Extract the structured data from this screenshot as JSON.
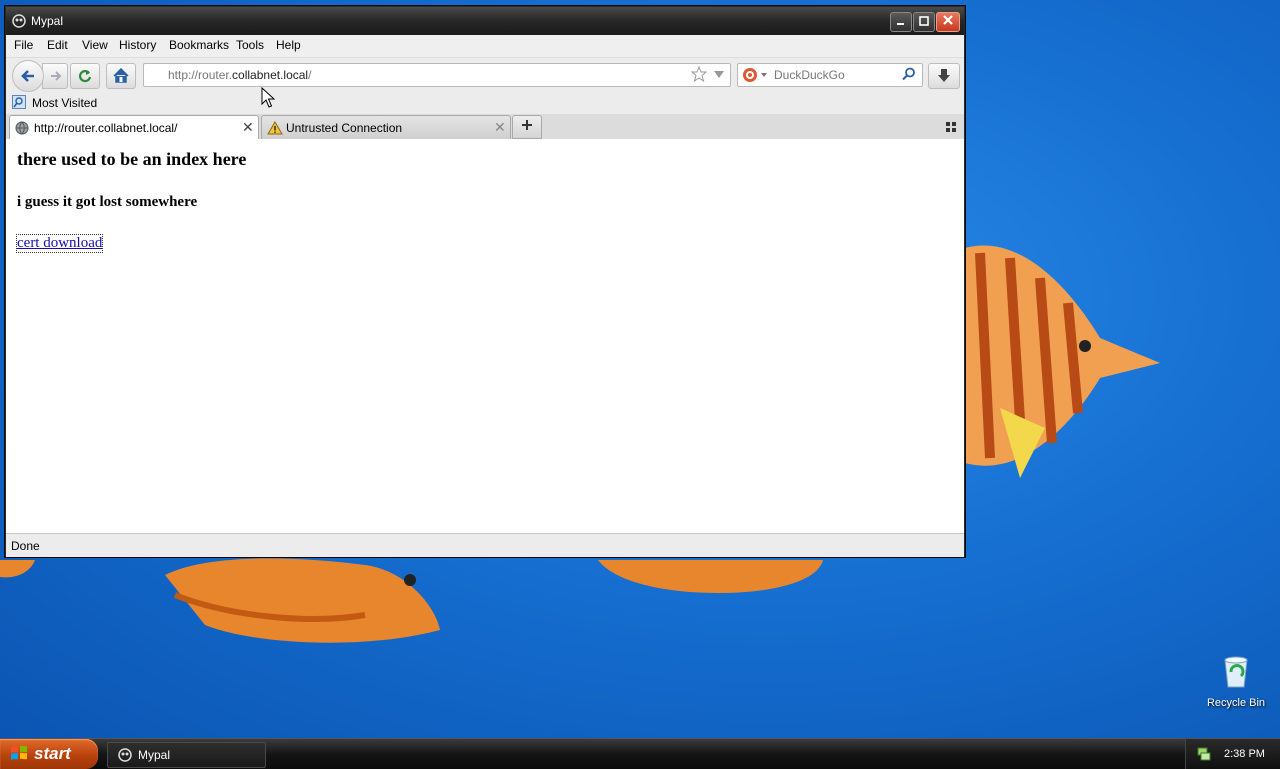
{
  "desktop": {
    "recycle_bin_label": "Recycle Bin"
  },
  "taskbar": {
    "start_label": "start",
    "task_label": "Mypal",
    "clock": "2:38 PM"
  },
  "window": {
    "title": "Mypal",
    "menu": [
      "File",
      "Edit",
      "View",
      "History",
      "Bookmarks",
      "Tools",
      "Help"
    ],
    "url_prefix": "http://router.",
    "url_domain": "collabnet.local",
    "url_suffix": "/",
    "search_placeholder": "DuckDuckGo",
    "bookmark": "Most Visited",
    "tabs": [
      {
        "label": "http://router.collabnet.local/",
        "active": true,
        "icon": "globe-icon"
      },
      {
        "label": "Untrusted Connection",
        "active": false,
        "icon": "warning-icon"
      }
    ],
    "status": "Done"
  },
  "page": {
    "heading": "there used to be an index here",
    "subheading": "i guess it got lost somewhere",
    "link": "cert download"
  },
  "colors": {
    "desktop": "#1670d2",
    "link": "#1a0dab",
    "close_button": "#c53b1f",
    "start_button": "#b8420e"
  }
}
